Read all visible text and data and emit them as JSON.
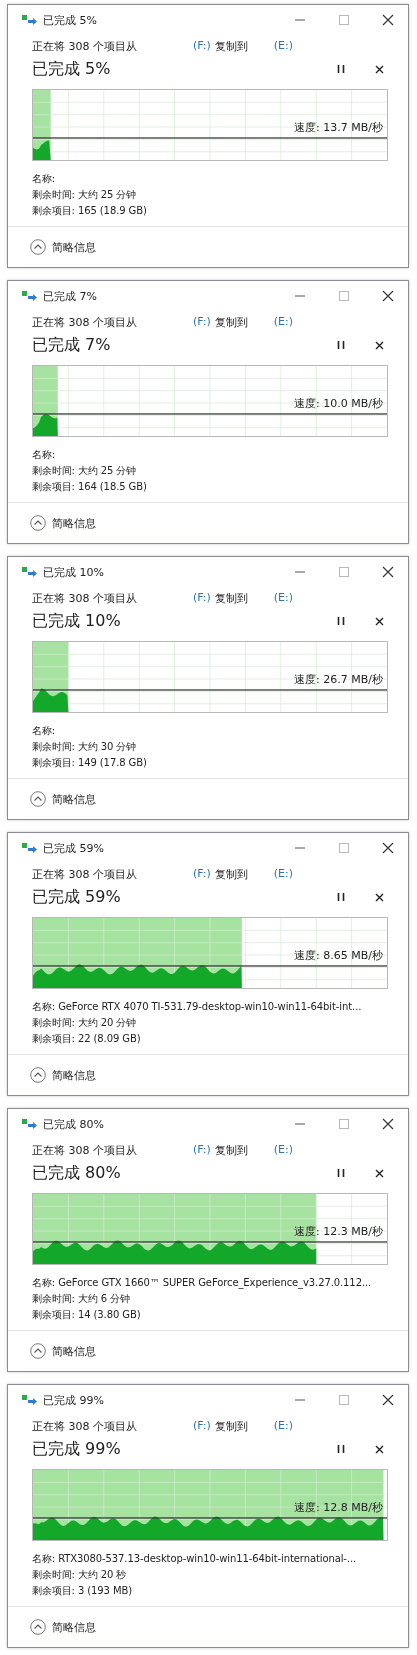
{
  "dialogs": [
    {
      "title": "已完成 5%",
      "prefix": "正在将 308 个项目从",
      "source": "(F:)",
      "verb": "复制到",
      "dest": "(E:)",
      "progress_text": "已完成 5%",
      "level": 0.05,
      "speed": "速度: 13.7 MB/秒",
      "name": "名称:",
      "time": "剩余时间: 大约 25 分钟",
      "items": "剩余项目: 165 (18.9 GB)",
      "details": "简略信息"
    },
    {
      "title": "已完成 7%",
      "prefix": "正在将 308 个项目从",
      "source": "(F:)",
      "verb": "复制到",
      "dest": "(E:)",
      "progress_text": "已完成 7%",
      "level": 0.07,
      "speed": "速度: 10.0 MB/秒",
      "name": "名称:",
      "time": "剩余时间: 大约 25 分钟",
      "items": "剩余项目: 164 (18.5 GB)",
      "details": "简略信息"
    },
    {
      "title": "已完成 10%",
      "prefix": "正在将 308 个项目从",
      "source": "(F:)",
      "verb": "复制到",
      "dest": "(E:)",
      "progress_text": "已完成 10%",
      "level": 0.1,
      "speed": "速度: 26.7 MB/秒",
      "name": "名称:",
      "time": "剩余时间: 大约 30 分钟",
      "items": "剩余项目: 149 (17.8 GB)",
      "details": "简略信息"
    },
    {
      "title": "已完成 59%",
      "prefix": "正在将 308 个项目从",
      "source": "(F:)",
      "verb": "复制到",
      "dest": "(E:)",
      "progress_text": "已完成 59%",
      "level": 0.59,
      "speed": "速度: 8.65 MB/秒",
      "name": "名称: GeForce RTX 4070 TI-531.79-desktop-win10-win11-64bit-int...",
      "time": "剩余时间: 大约 20 分钟",
      "items": "剩余项目: 22 (8.09 GB)",
      "details": "简略信息"
    },
    {
      "title": "已完成 80%",
      "prefix": "正在将 308 个项目从",
      "source": "(F:)",
      "verb": "复制到",
      "dest": "(E:)",
      "progress_text": "已完成 80%",
      "level": 0.8,
      "speed": "速度: 12.3 MB/秒",
      "name": "名称: GeForce GTX 1660™ SUPER GeForce_Experience_v3.27.0.112...",
      "time": "剩余时间: 大约 6 分钟",
      "items": "剩余项目: 14 (3.80 GB)",
      "details": "简略信息"
    },
    {
      "title": "已完成 99%",
      "prefix": "正在将 308 个项目从",
      "source": "(F:)",
      "verb": "复制到",
      "dest": "(E:)",
      "progress_text": "已完成 99%",
      "level": 0.99,
      "speed": "速度: 12.8 MB/秒",
      "name": "名称: RTX3080-537.13-desktop-win10-win11-64bit-international-...",
      "time": "剩余时间: 大约 20 秒",
      "items": "剩余项目: 3 (193 MB)",
      "details": "简略信息"
    }
  ]
}
